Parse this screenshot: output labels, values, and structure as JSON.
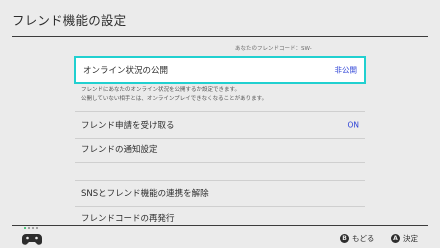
{
  "header": {
    "title": "フレンド機能の設定"
  },
  "friend_code": {
    "label": "あなたのフレンドコード：SW-"
  },
  "rows": {
    "online_status": {
      "label": "オンライン状況の公開",
      "value": "非公開"
    },
    "friend_requests": {
      "label": "フレンド申請を受け取る",
      "value": "ON"
    },
    "notifications": {
      "label": "フレンドの通知設定"
    },
    "sns_unlink": {
      "label": "SNSとフレンド機能の連携を解除"
    },
    "reissue_code": {
      "label": "フレンドコードの再発行"
    }
  },
  "description": {
    "line1": "フレンドにあなたのオンライン状況を公開するか設定できます。",
    "line2": "公開していない相手とは、オンラインプレイできなくなることがあります。"
  },
  "footer": {
    "back": {
      "key": "B",
      "label": "もどる"
    },
    "ok": {
      "key": "A",
      "label": "決定"
    }
  },
  "colors": {
    "focus_border": "#21d0d0",
    "value_text": "#2a3fd6",
    "background": "#ebebeb"
  },
  "icons": {
    "controller": "controller-icon"
  }
}
